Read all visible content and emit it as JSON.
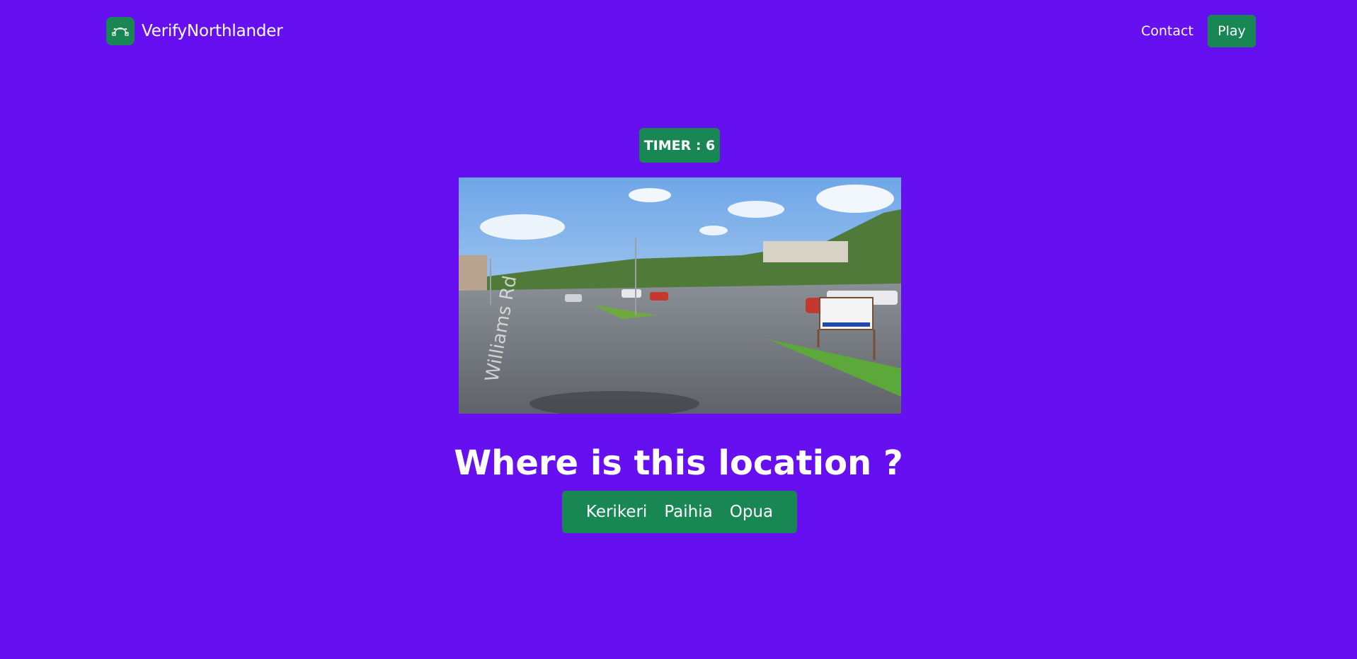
{
  "navbar": {
    "brand_name": "VerifyNorthlander",
    "brand_icon": "bezier-curve-icon",
    "contact_label": "Contact",
    "play_label": "Play"
  },
  "game": {
    "timer_text": "TIMER : 6",
    "photo_alt": "Street view photo",
    "question": "Where is this location ?",
    "options": [
      "Kerikeri",
      "Paihia",
      "Opua"
    ]
  },
  "colors": {
    "background": "#6610f2",
    "accent": "#198754",
    "text": "#ffffff"
  }
}
